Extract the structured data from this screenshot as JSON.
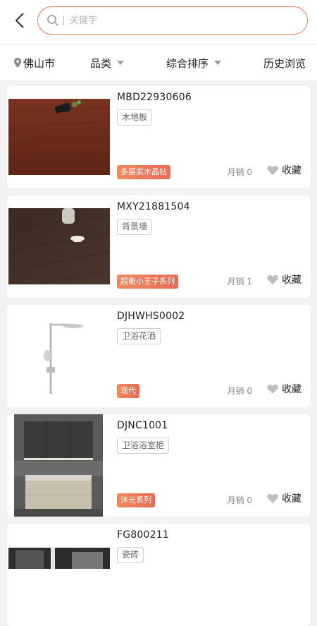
{
  "search": {
    "placeholder": "关键字"
  },
  "filters": {
    "city": "佛山市",
    "category": "品类",
    "sort": "综合排序",
    "history": "历史浏览"
  },
  "colors": {
    "accent": "#e87e5a",
    "tag_gradient_start": "#f08a5d",
    "tag_gradient_end": "#e86a5a"
  },
  "products": [
    {
      "code": "MBD22930606",
      "category": "木地板",
      "series": "多层实木晶钻",
      "sales": "月销 0",
      "fav": "收藏",
      "image": "wood-floor-dark-red"
    },
    {
      "code": "MXY21881504",
      "category": "背景墙",
      "series": "超能小王子系列",
      "sales": "月销 1",
      "fav": "收藏",
      "image": "wood-floor-dark-brown"
    },
    {
      "code": "DJHWHS0002",
      "category": "卫浴花洒",
      "series": "现代",
      "sales": "月销 0",
      "fav": "收藏",
      "image": "shower-set"
    },
    {
      "code": "DJNC1001",
      "category": "卫浴浴室柜",
      "series": "沐光系列",
      "sales": "月销 0",
      "fav": "收藏",
      "image": "bathroom-cabinet"
    },
    {
      "code": "FG800211",
      "category": "瓷砖",
      "series": "",
      "sales": "",
      "fav": "",
      "image": "tile-room"
    }
  ]
}
